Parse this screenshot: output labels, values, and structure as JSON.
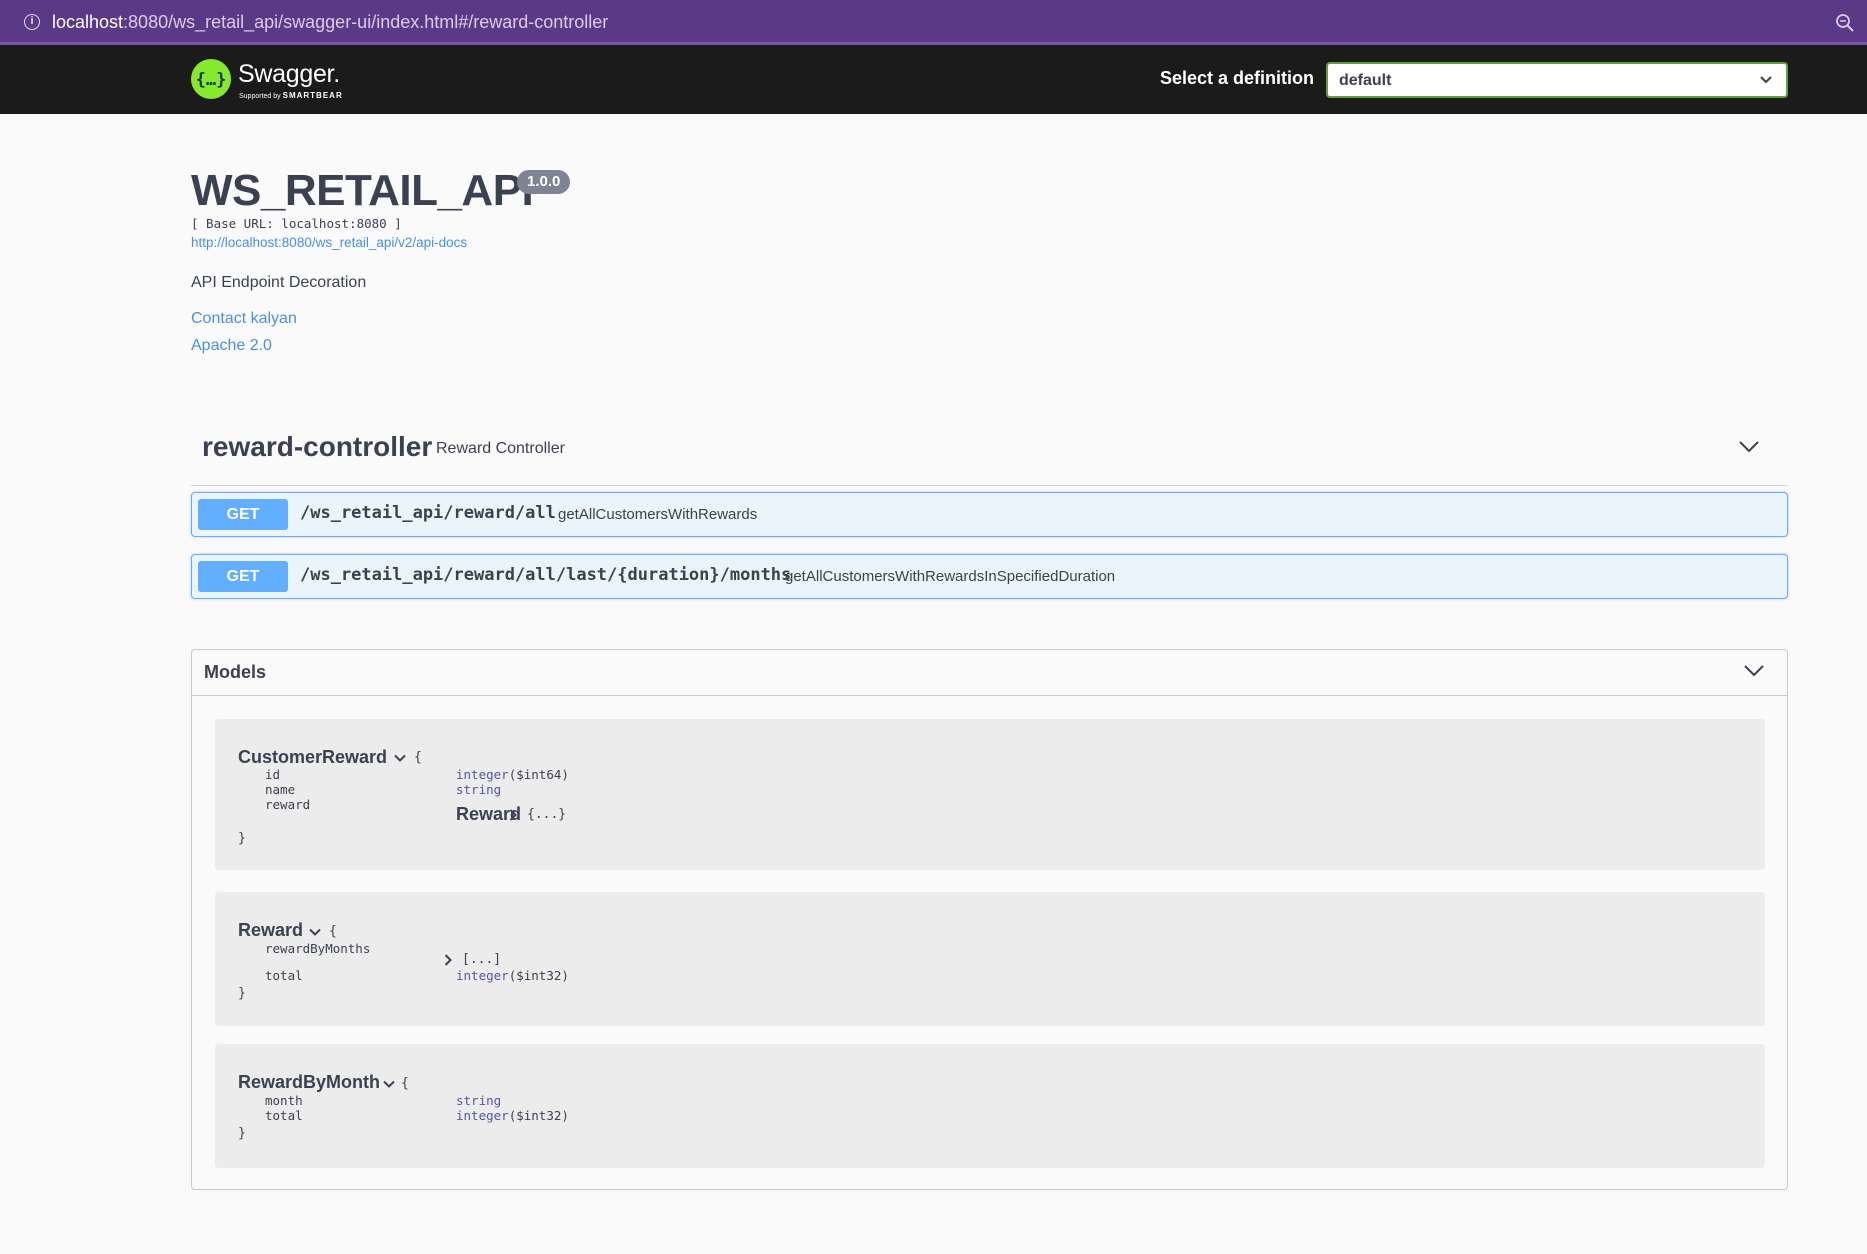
{
  "browser": {
    "url_host": "localhost",
    "url_rest": ":8080/ws_retail_api/swagger-ui/index.html#/reward-controller"
  },
  "topbar": {
    "logo_name": "Swagger.",
    "logo_support": "Supported by",
    "logo_brand": "SMARTBEAR",
    "definition_label": "Select a definition",
    "definition_value": "default"
  },
  "info": {
    "title": "WS_RETAIL_API",
    "version": "1.0.0",
    "base_url": "[ Base URL: localhost:8080 ]",
    "api_docs_link": "http://localhost:8080/ws_retail_api/v2/api-docs",
    "description": "API Endpoint Decoration",
    "contact": "Contact kalyan",
    "license": "Apache 2.0"
  },
  "tag": {
    "name": "reward-controller",
    "description": "Reward Controller"
  },
  "operations": [
    {
      "method": "GET",
      "path": "/ws_retail_api/reward/all",
      "summary": "getAllCustomersWithRewards"
    },
    {
      "method": "GET",
      "path": "/ws_retail_api/reward/all/last/{duration}/months",
      "summary": "getAllCustomersWithRewardsInSpecifiedDuration"
    }
  ],
  "models": {
    "title": "Models",
    "items": [
      {
        "name": "CustomerReward",
        "open": "{",
        "close": "}",
        "props": [
          {
            "name": "id",
            "type": "integer",
            "format": "($int64)"
          },
          {
            "name": "name",
            "type": "string",
            "format": ""
          },
          {
            "name": "reward",
            "ref": "Reward",
            "collapsed": "{...}"
          }
        ]
      },
      {
        "name": "Reward",
        "open": "{",
        "close": "}",
        "props": [
          {
            "name": "rewardByMonths",
            "collapsed": "[...]"
          },
          {
            "name": "total",
            "type": "integer",
            "format": "($int32)"
          }
        ]
      },
      {
        "name": "RewardByMonth",
        "open": "{",
        "close": "}",
        "props": [
          {
            "name": "month",
            "type": "string",
            "format": ""
          },
          {
            "name": "total",
            "type": "integer",
            "format": "($int32)"
          }
        ]
      }
    ]
  },
  "colors": {
    "get_method": "#61affe",
    "link": "#4990e2",
    "swagger_green": "#85ea2d",
    "browser_bar": "#5a3a86"
  }
}
